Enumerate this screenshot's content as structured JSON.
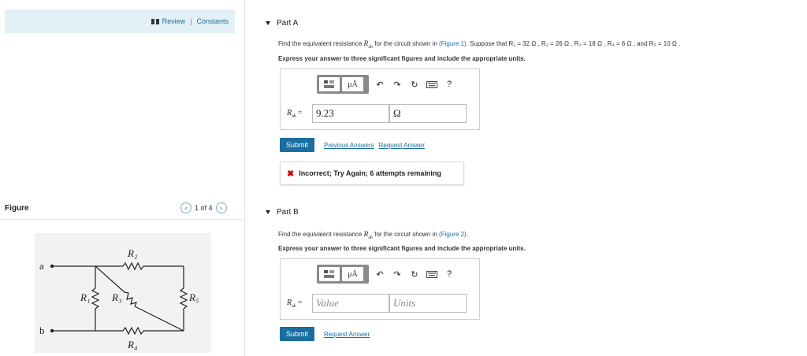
{
  "left": {
    "review_label": "Review",
    "constants_label": "Constants",
    "separator": "|",
    "figure_label": "Figure",
    "pager_text": "1 of 4",
    "circuit": {
      "node_a": "a",
      "node_b": "b",
      "r1": "R₁",
      "r2": "R₂",
      "r3": "R₃",
      "r4": "R₄",
      "r5": "R₅"
    }
  },
  "partA": {
    "title": "Part A",
    "q_pre": "Find the equivalent resistance ",
    "q_var": "R",
    "q_var_sub": "ab",
    "q_mid": " for the circuit shown in ",
    "q_link": "(Figure 1)",
    "q_post": ". Suppose that R₁ = 32  Ω , R₂ = 26  Ω , R₃ = 18  Ω , R₄ = 6  Ω , and R₅ = 10  Ω .",
    "instruction": "Express your answer to three significant figures and include the appropriate units.",
    "answer_label": "R",
    "answer_label_sub": "ab",
    "answer_eq": " =",
    "value": "9.23",
    "units": "Ω",
    "submit": "Submit",
    "previous_answers": "Previous Answers",
    "request_answer": "Request Answer",
    "feedback": "Incorrect; Try Again; 6 attempts remaining"
  },
  "partB": {
    "title": "Part B",
    "q_pre": "Find the equivalent resistance ",
    "q_var": "R",
    "q_var_sub": "ab",
    "q_mid": " for the circuit shown in ",
    "q_link": "(Figure 2)",
    "q_post": ".",
    "instruction": "Express your answer to three significant figures and include the appropriate units.",
    "answer_label": "R",
    "answer_label_sub": "ab",
    "answer_eq": " =",
    "value_placeholder": "Value",
    "units_placeholder": "Units",
    "submit": "Submit",
    "request_answer": "Request Answer"
  },
  "toolbar": {
    "templates_icon": "templates-icon",
    "mu_label": "μÅ",
    "undo_icon": "undo-icon",
    "redo_icon": "redo-icon",
    "reset_icon": "reset-icon",
    "keyboard_icon": "keyboard-icon",
    "help_label": "?"
  },
  "colors": {
    "accent": "#1a6ea0",
    "review_bar": "#e3f1f6",
    "error": "#cc0000"
  }
}
